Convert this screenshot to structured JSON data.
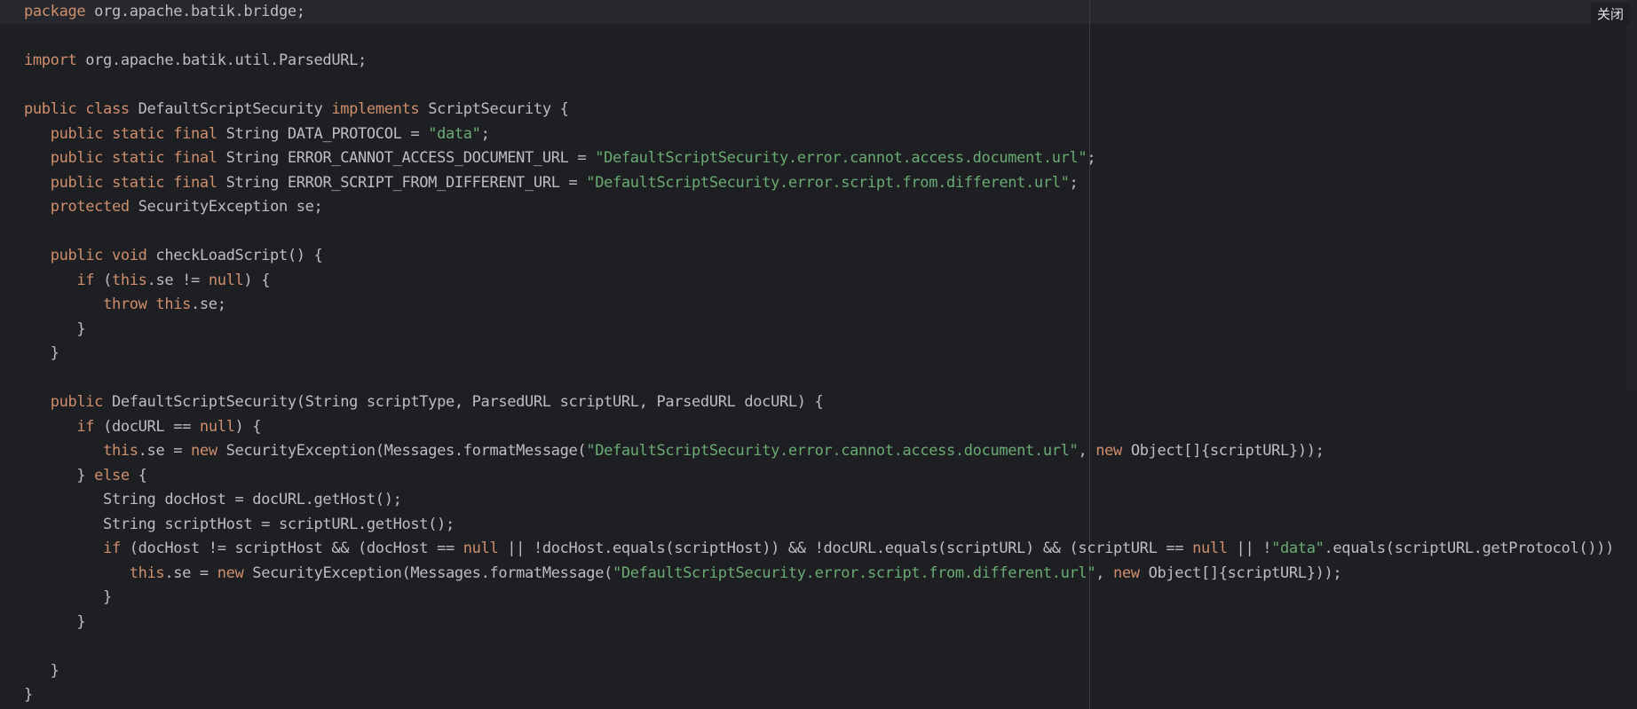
{
  "toolbar": {
    "close_label": "关闭"
  },
  "colors": {
    "background": "#1e1f22",
    "current_line": "#26282e",
    "keyword": "#cf8e6d",
    "string": "#6aab73",
    "text": "#bcbec4"
  },
  "code": {
    "language": "java",
    "lines": [
      [
        {
          "t": "kw",
          "v": "package"
        },
        {
          "t": "plain",
          "v": " org.apache.batik.bridge;"
        }
      ],
      [],
      [
        {
          "t": "kw",
          "v": "import"
        },
        {
          "t": "plain",
          "v": " org.apache.batik.util.ParsedURL;"
        }
      ],
      [],
      [
        {
          "t": "kw",
          "v": "public class"
        },
        {
          "t": "plain",
          "v": " DefaultScriptSecurity "
        },
        {
          "t": "kw",
          "v": "implements"
        },
        {
          "t": "plain",
          "v": " ScriptSecurity {"
        }
      ],
      [
        {
          "t": "plain",
          "v": "   "
        },
        {
          "t": "kw",
          "v": "public static final"
        },
        {
          "t": "plain",
          "v": " String DATA_PROTOCOL = "
        },
        {
          "t": "str",
          "v": "\"data\""
        },
        {
          "t": "plain",
          "v": ";"
        }
      ],
      [
        {
          "t": "plain",
          "v": "   "
        },
        {
          "t": "kw",
          "v": "public static final"
        },
        {
          "t": "plain",
          "v": " String ERROR_CANNOT_ACCESS_DOCUMENT_URL = "
        },
        {
          "t": "str",
          "v": "\"DefaultScriptSecurity.error.cannot.access.document.url\""
        },
        {
          "t": "plain",
          "v": ";"
        }
      ],
      [
        {
          "t": "plain",
          "v": "   "
        },
        {
          "t": "kw",
          "v": "public static final"
        },
        {
          "t": "plain",
          "v": " String ERROR_SCRIPT_FROM_DIFFERENT_URL = "
        },
        {
          "t": "str",
          "v": "\"DefaultScriptSecurity.error.script.from.different.url\""
        },
        {
          "t": "plain",
          "v": ";"
        }
      ],
      [
        {
          "t": "plain",
          "v": "   "
        },
        {
          "t": "kw",
          "v": "protected"
        },
        {
          "t": "plain",
          "v": " SecurityException se;"
        }
      ],
      [],
      [
        {
          "t": "plain",
          "v": "   "
        },
        {
          "t": "kw",
          "v": "public void"
        },
        {
          "t": "plain",
          "v": " checkLoadScript() {"
        }
      ],
      [
        {
          "t": "plain",
          "v": "      "
        },
        {
          "t": "kw",
          "v": "if"
        },
        {
          "t": "plain",
          "v": " ("
        },
        {
          "t": "kw",
          "v": "this"
        },
        {
          "t": "plain",
          "v": ".se != "
        },
        {
          "t": "kw",
          "v": "null"
        },
        {
          "t": "plain",
          "v": ") {"
        }
      ],
      [
        {
          "t": "plain",
          "v": "         "
        },
        {
          "t": "kw",
          "v": "throw this"
        },
        {
          "t": "plain",
          "v": ".se;"
        }
      ],
      [
        {
          "t": "plain",
          "v": "      }"
        }
      ],
      [
        {
          "t": "plain",
          "v": "   }"
        }
      ],
      [],
      [
        {
          "t": "plain",
          "v": "   "
        },
        {
          "t": "kw",
          "v": "public"
        },
        {
          "t": "plain",
          "v": " DefaultScriptSecurity(String scriptType, ParsedURL scriptURL, ParsedURL docURL) {"
        }
      ],
      [
        {
          "t": "plain",
          "v": "      "
        },
        {
          "t": "kw",
          "v": "if"
        },
        {
          "t": "plain",
          "v": " (docURL == "
        },
        {
          "t": "kw",
          "v": "null"
        },
        {
          "t": "plain",
          "v": ") {"
        }
      ],
      [
        {
          "t": "plain",
          "v": "         "
        },
        {
          "t": "kw",
          "v": "this"
        },
        {
          "t": "plain",
          "v": ".se = "
        },
        {
          "t": "kw",
          "v": "new"
        },
        {
          "t": "plain",
          "v": " SecurityException(Messages.formatMessage("
        },
        {
          "t": "str",
          "v": "\"DefaultScriptSecurity.error.cannot.access.document.url\""
        },
        {
          "t": "plain",
          "v": ", "
        },
        {
          "t": "kw",
          "v": "new"
        },
        {
          "t": "plain",
          "v": " Object[]{scriptURL}));"
        }
      ],
      [
        {
          "t": "plain",
          "v": "      } "
        },
        {
          "t": "kw",
          "v": "else"
        },
        {
          "t": "plain",
          "v": " {"
        }
      ],
      [
        {
          "t": "plain",
          "v": "         String docHost = docURL.getHost();"
        }
      ],
      [
        {
          "t": "plain",
          "v": "         String scriptHost = scriptURL.getHost();"
        }
      ],
      [
        {
          "t": "plain",
          "v": "         "
        },
        {
          "t": "kw",
          "v": "if"
        },
        {
          "t": "plain",
          "v": " (docHost != scriptHost && (docHost == "
        },
        {
          "t": "kw",
          "v": "null"
        },
        {
          "t": "plain",
          "v": " || !docHost.equals(scriptHost)) && !docURL.equals(scriptURL) && (scriptURL == "
        },
        {
          "t": "kw",
          "v": "null"
        },
        {
          "t": "plain",
          "v": " || !"
        },
        {
          "t": "str",
          "v": "\"data\""
        },
        {
          "t": "plain",
          "v": ".equals(scriptURL.getProtocol()))"
        }
      ],
      [
        {
          "t": "plain",
          "v": "            "
        },
        {
          "t": "kw",
          "v": "this"
        },
        {
          "t": "plain",
          "v": ".se = "
        },
        {
          "t": "kw",
          "v": "new"
        },
        {
          "t": "plain",
          "v": " SecurityException(Messages.formatMessage("
        },
        {
          "t": "str",
          "v": "\"DefaultScriptSecurity.error.script.from.different.url\""
        },
        {
          "t": "plain",
          "v": ", "
        },
        {
          "t": "kw",
          "v": "new"
        },
        {
          "t": "plain",
          "v": " Object[]{scriptURL}));"
        }
      ],
      [
        {
          "t": "plain",
          "v": "         }"
        }
      ],
      [
        {
          "t": "plain",
          "v": "      }"
        }
      ],
      [],
      [
        {
          "t": "plain",
          "v": "   }"
        }
      ],
      [
        {
          "t": "plain",
          "v": "}"
        }
      ]
    ]
  }
}
